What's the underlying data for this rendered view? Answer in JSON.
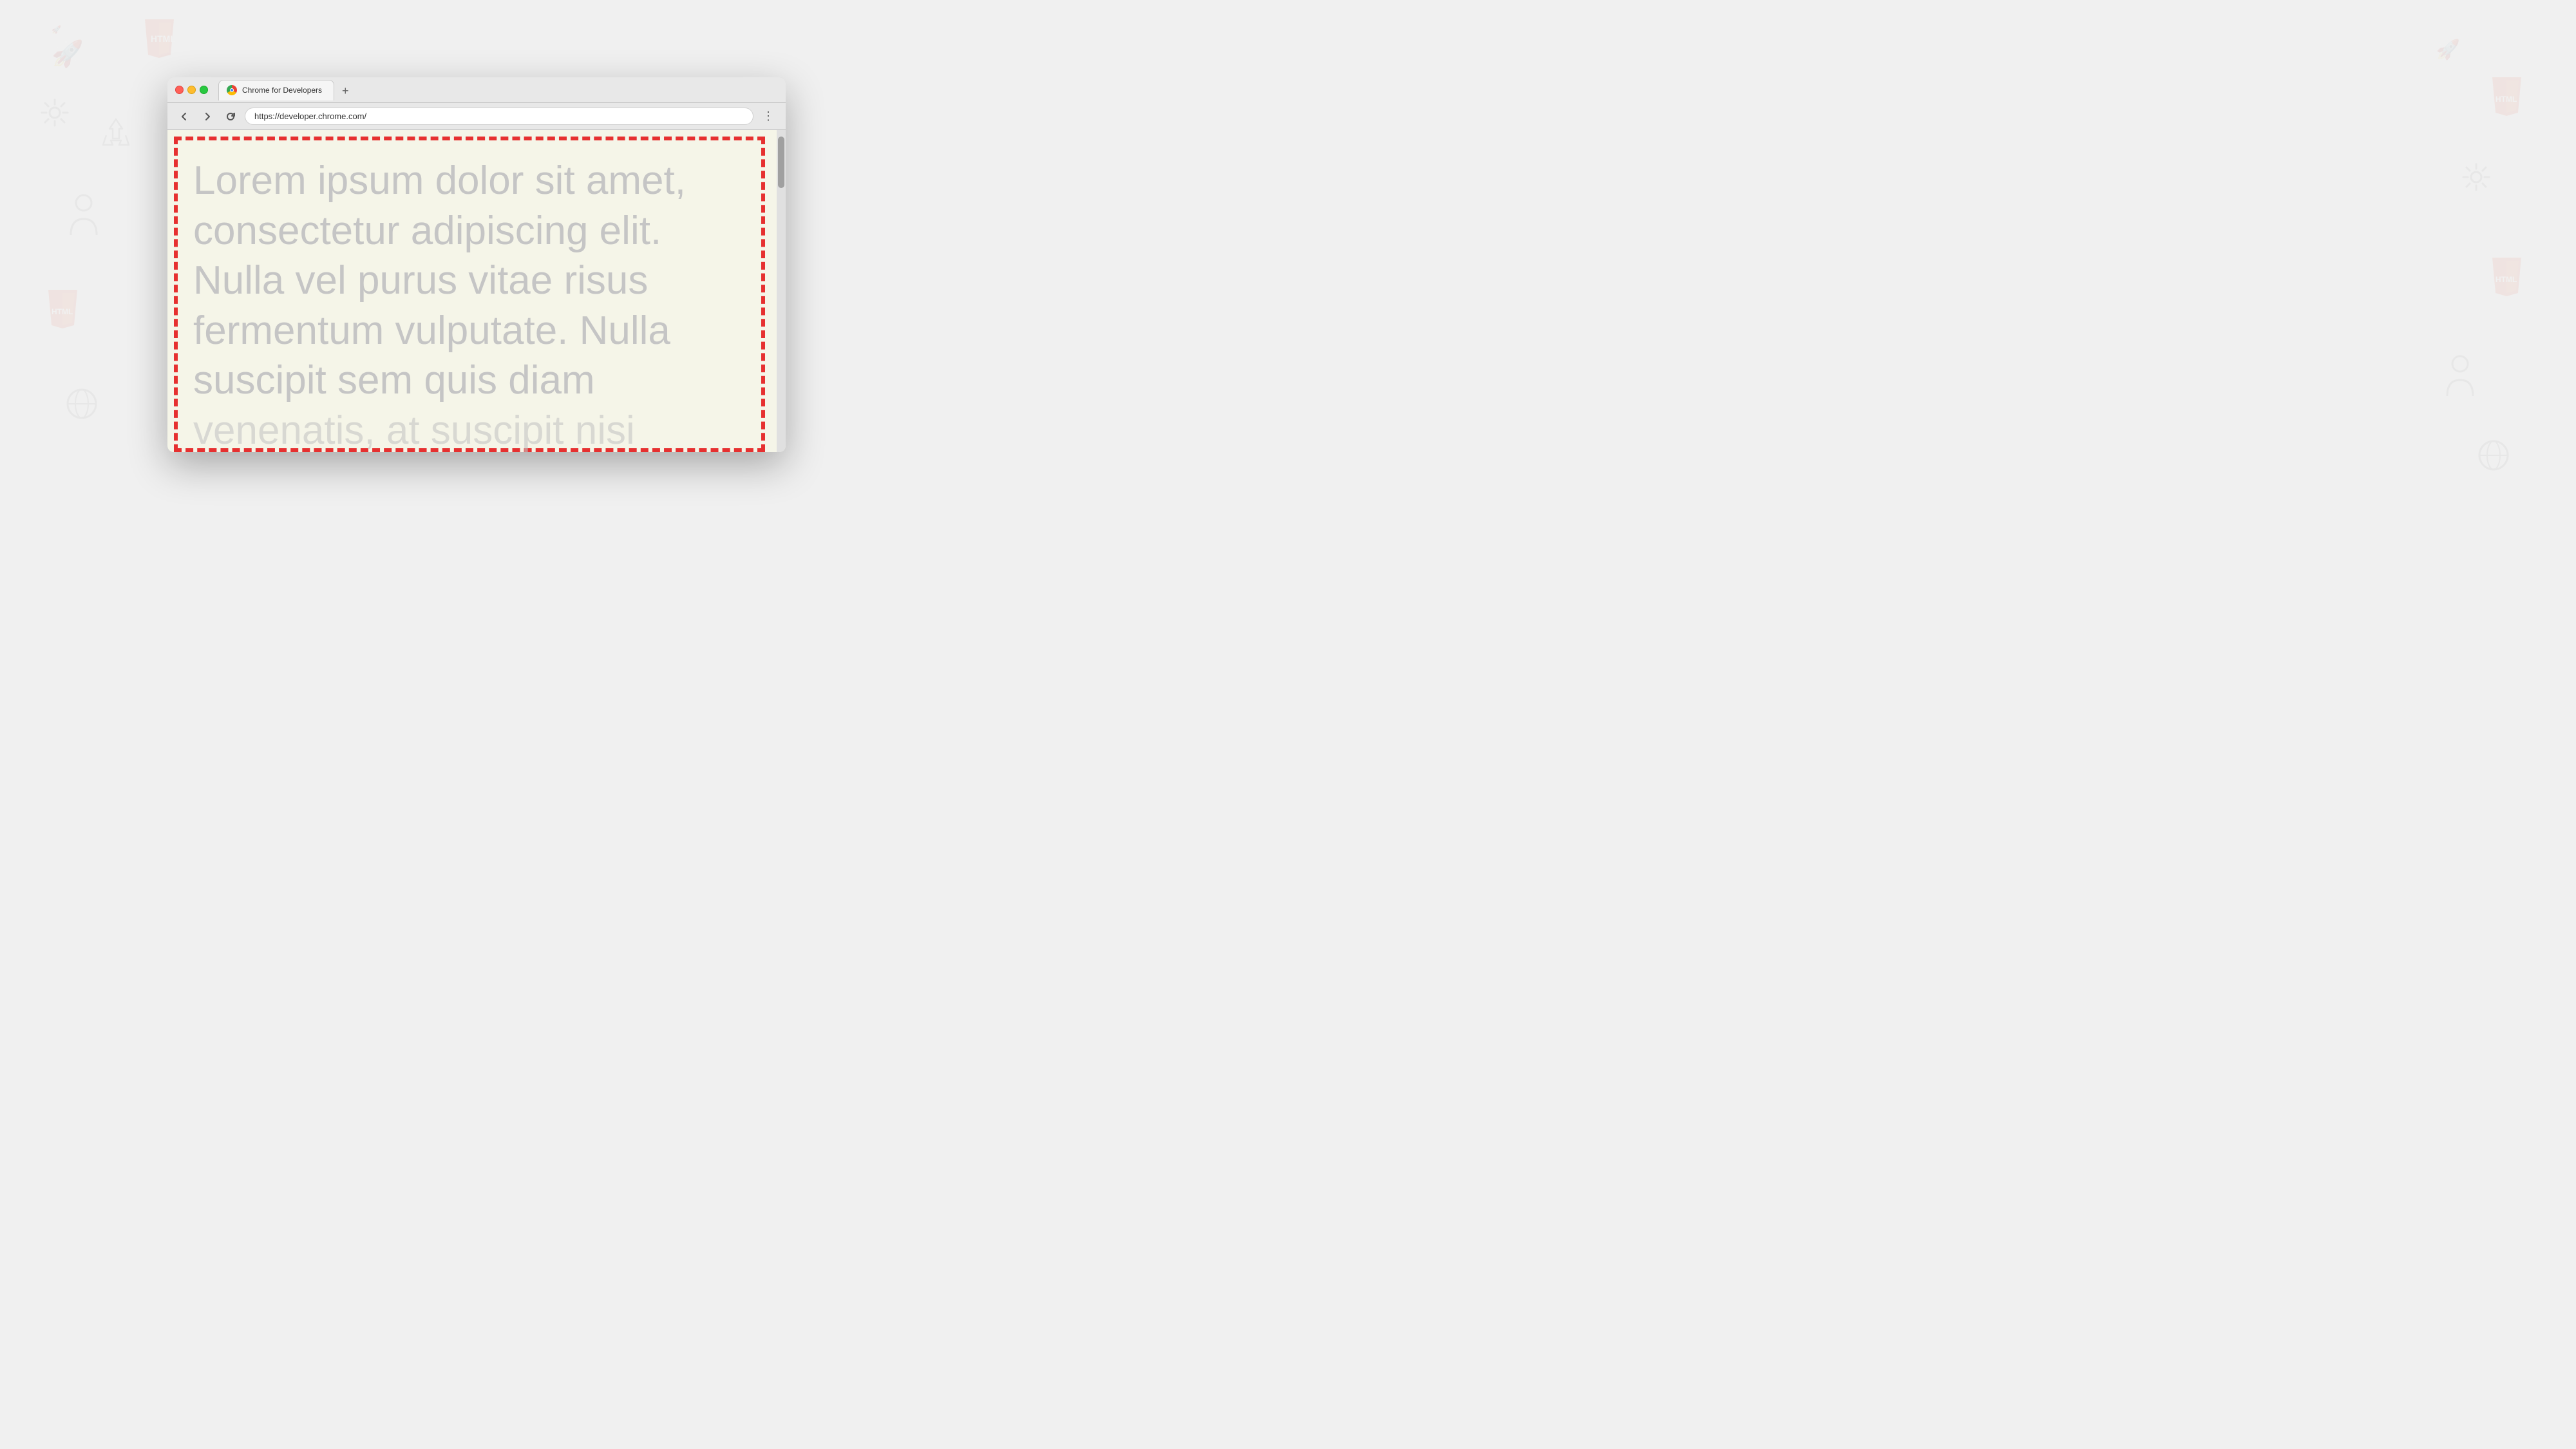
{
  "background": {
    "color": "#f0f0f0"
  },
  "browser": {
    "tab": {
      "title": "Chrome for Developers",
      "favicon": "chrome-icon"
    },
    "new_tab_label": "+",
    "url": "https://developer.chrome.com/",
    "nav": {
      "back_disabled": false,
      "forward_disabled": false
    },
    "menu_icon": "⋮"
  },
  "content": {
    "background": "#f5f5e8",
    "lorem_text": "Lorem ipsum dolor sit amet, consectetur adipiscing elit. Nulla vel purus vitae risus fermentum vulputate. Nulla suscipit sem quis diam venenatis, at suscipit nisi eleifend. Nulla pretium eget",
    "text_color": "#c5c5c5",
    "border_color": "#e63030"
  }
}
